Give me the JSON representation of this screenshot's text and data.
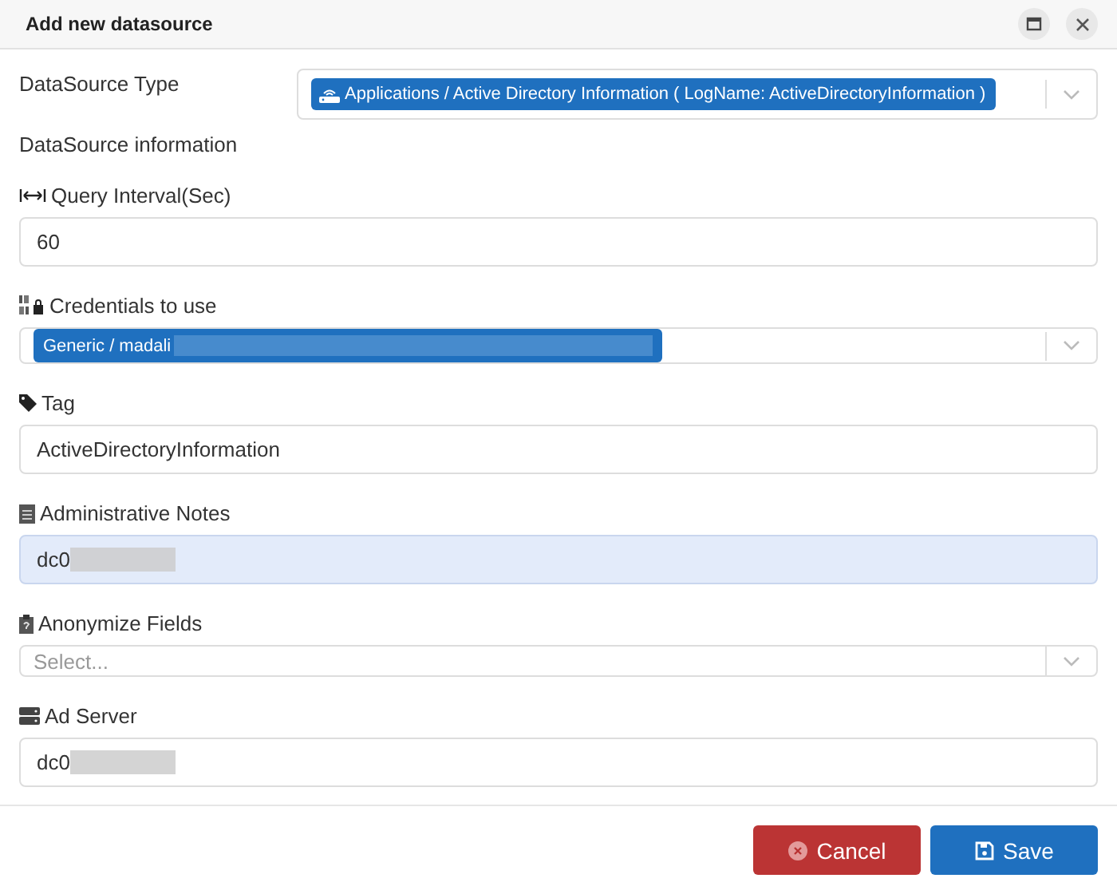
{
  "dialog": {
    "title": "Add new datasource"
  },
  "datasource_type": {
    "label": "DataSource Type",
    "value": "Applications / Active Directory Information ( LogName: ActiveDirectoryInformation )"
  },
  "section_label": "DataSource information",
  "fields": [
    {
      "kind": "input",
      "label": "Query Interval(Sec)",
      "value": "60",
      "highlighted": false
    },
    {
      "kind": "tags",
      "label": "Credentials to use",
      "value": "Generic / madali",
      "redacted": true
    },
    {
      "kind": "input",
      "label": "Tag",
      "value": "ActiveDirectoryInformation",
      "highlighted": false
    },
    {
      "kind": "input",
      "label": "Administrative Notes",
      "value": "dc0",
      "redacted": true,
      "highlighted": true
    },
    {
      "kind": "select",
      "label": "Anonymize Fields",
      "placeholder": "Select..."
    },
    {
      "kind": "input",
      "label": "Ad Server",
      "value": "dc0",
      "redacted": true,
      "highlighted": false
    }
  ],
  "buttons": [
    {
      "kind": "cancel",
      "label": "Cancel"
    },
    {
      "kind": "save",
      "label": "Save"
    }
  ]
}
